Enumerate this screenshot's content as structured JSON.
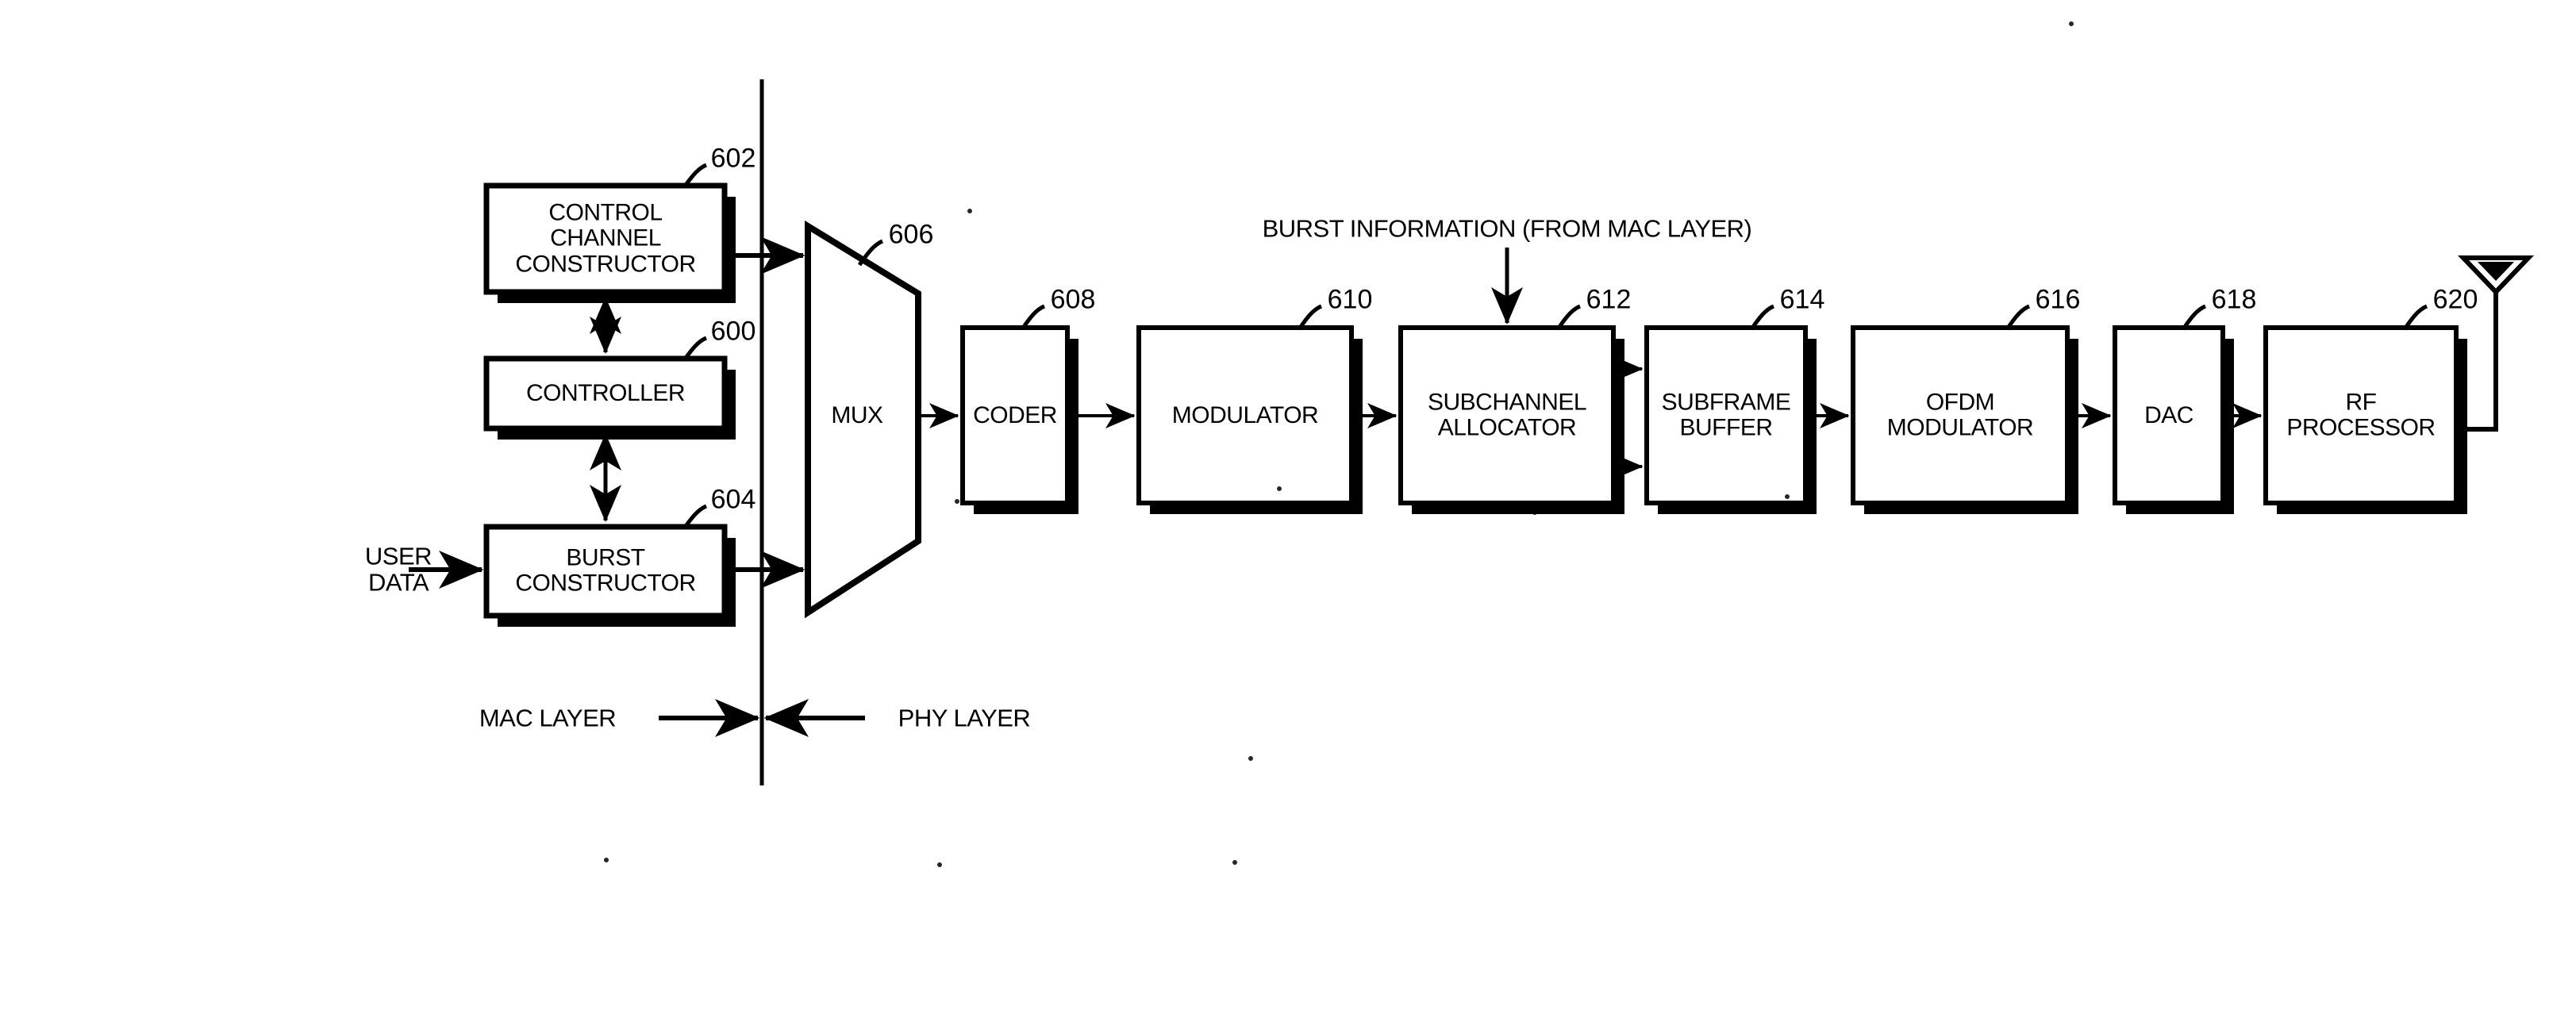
{
  "figure": {
    "type": "block-diagram",
    "description": "OFDM transmitter block diagram showing MAC layer and PHY layer partition"
  },
  "layer_labels": {
    "mac": "MAC LAYER",
    "phy": "PHY LAYER"
  },
  "annotations": {
    "burst_information": "BURST INFORMATION (FROM MAC LAYER)",
    "user_data": "USER\nDATA"
  },
  "blocks": [
    {
      "id": "control-channel-constructor",
      "label": "CONTROL\nCHANNEL\nCONSTRUCTOR",
      "ref": "602"
    },
    {
      "id": "controller",
      "label": "CONTROLLER",
      "ref": "600"
    },
    {
      "id": "burst-constructor",
      "label": "BURST\nCONSTRUCTOR",
      "ref": "604"
    },
    {
      "id": "mux",
      "label": "MUX",
      "ref": "606"
    },
    {
      "id": "coder",
      "label": "CODER",
      "ref": "608"
    },
    {
      "id": "modulator",
      "label": "MODULATOR",
      "ref": "610"
    },
    {
      "id": "subchannel-allocator",
      "label": "SUBCHANNEL\nALLOCATOR",
      "ref": "612"
    },
    {
      "id": "subframe-buffer",
      "label": "SUBFRAME\nBUFFER",
      "ref": "614"
    },
    {
      "id": "ofdm-modulator",
      "label": "OFDM\nMODULATOR",
      "ref": "616"
    },
    {
      "id": "dac",
      "label": "DAC",
      "ref": "618"
    },
    {
      "id": "rf-processor",
      "label": "RF\nPROCESSOR",
      "ref": "620"
    }
  ],
  "colors": {
    "stroke": "#000000",
    "fill": "#ffffff",
    "shadow": "#000000",
    "background": "#ffffff"
  }
}
